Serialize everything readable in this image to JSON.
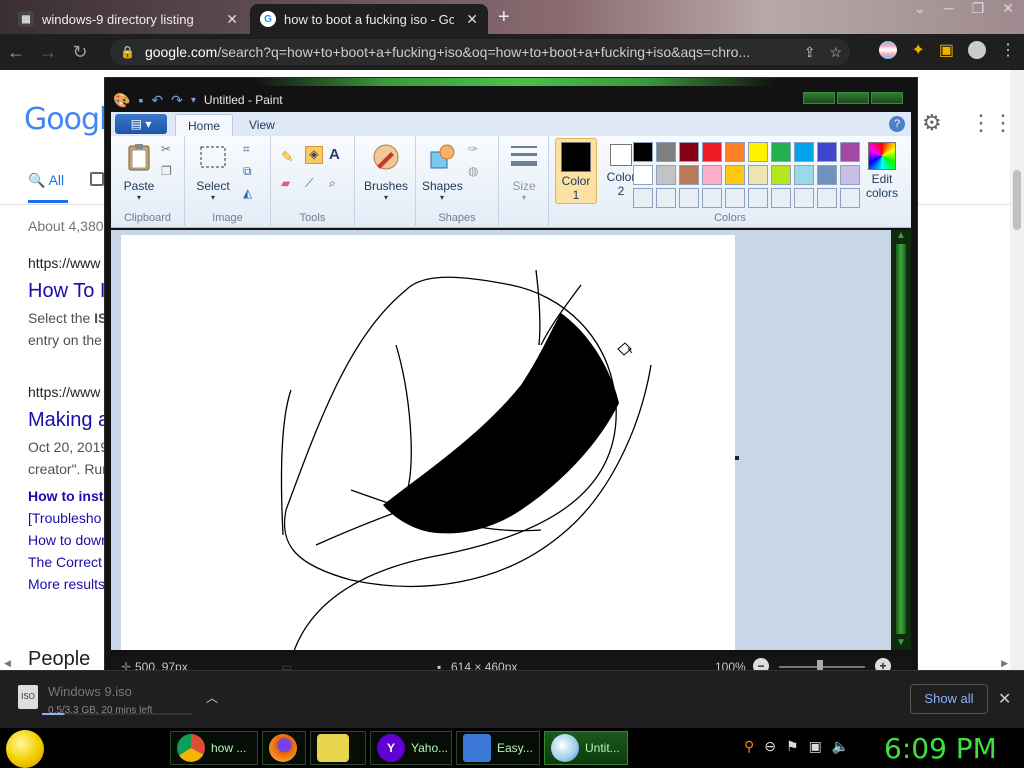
{
  "browser": {
    "tabs": [
      {
        "title": "windows-9 directory listing",
        "favicon": "archive-icon"
      },
      {
        "title": "how to boot a fucking iso - Goo",
        "favicon": "google-icon"
      }
    ],
    "url_host": "google.com",
    "url_path": "/search?q=how+to+boot+a+fucking+iso&oq=how+to+boot+a+fucking+iso&aqs=chro..."
  },
  "google": {
    "logo": "Google",
    "tab_all": "All",
    "result_count": "About 4,380",
    "results": [
      {
        "url": "https://www",
        "title": "How To I",
        "snippet_1_pre": "Select the ",
        "snippet_1_bold": "IS",
        "snippet_2": "entry on the"
      },
      {
        "url": "https://www",
        "title": "Making a",
        "snippet_1": "Oct 20, 2019",
        "snippet_2": "creator\". Run"
      }
    ],
    "sublinks": [
      "How to insta",
      "[Troublesho",
      "How to down",
      "The Correct",
      "More results"
    ],
    "people_heading": "People"
  },
  "paint": {
    "title": "Untitled - Paint",
    "file_menu": "▤ ▾",
    "tabs": [
      "Home",
      "View"
    ],
    "help": "?",
    "groups": {
      "clipboard": "Clipboard",
      "image": "Image",
      "tools": "Tools",
      "shapes": "Shapes",
      "colors": "Colors"
    },
    "buttons": {
      "paste": "Paste",
      "select": "Select",
      "brushes": "Brushes",
      "shapes": "Shapes",
      "size": "Size",
      "color1_line1": "Color",
      "color1_line2": "1",
      "color2_line1": "Color",
      "color2_line2": "2",
      "edit_line1": "Edit",
      "edit_line2": "colors"
    },
    "palette": [
      "#000000",
      "#7f7f7f",
      "#880015",
      "#ed1c24",
      "#ff7f27",
      "#fff200",
      "#22b14c",
      "#00a2e8",
      "#3f48cc",
      "#a349a4",
      "#ffffff",
      "#c3c3c3",
      "#b97a57",
      "#ffaec9",
      "#ffc90e",
      "#efe4b0",
      "#b5e61d",
      "#99d9ea",
      "#7092be",
      "#c8bfe7",
      "#e8eef6",
      "#e8eef6",
      "#e8eef6",
      "#e8eef6",
      "#e8eef6",
      "#e8eef6",
      "#e8eef6",
      "#e8eef6",
      "#e8eef6",
      "#e8eef6"
    ],
    "color1": "#000000",
    "color2": "#ffffff",
    "status": {
      "cursor_pos": "500, 97px",
      "canvas_size": "614 × 460px",
      "zoom": "100%"
    }
  },
  "download": {
    "filename": "Windows 9.iso",
    "status": "0.5/3.3 GB, 20 mins left",
    "progress": 0.15,
    "show_all": "Show all",
    "icon_label": "ISO"
  },
  "taskbar": {
    "items": [
      {
        "label": "how ...",
        "icon": "chrome-icon",
        "color": "#dd4b39"
      },
      {
        "label": "",
        "icon": "firefox-icon",
        "color": "#e66000"
      },
      {
        "label": "",
        "icon": "folder-icon",
        "color": "#e8d44d"
      },
      {
        "label": "Yaho...",
        "icon": "yahoo-icon",
        "color": "#6001d2"
      },
      {
        "label": "Easy...",
        "icon": "computer-icon",
        "color": "#3c78d8"
      },
      {
        "label": "Untit...",
        "icon": "paint-icon",
        "color": "#9acdea"
      }
    ],
    "clock": "6:09 PM"
  }
}
